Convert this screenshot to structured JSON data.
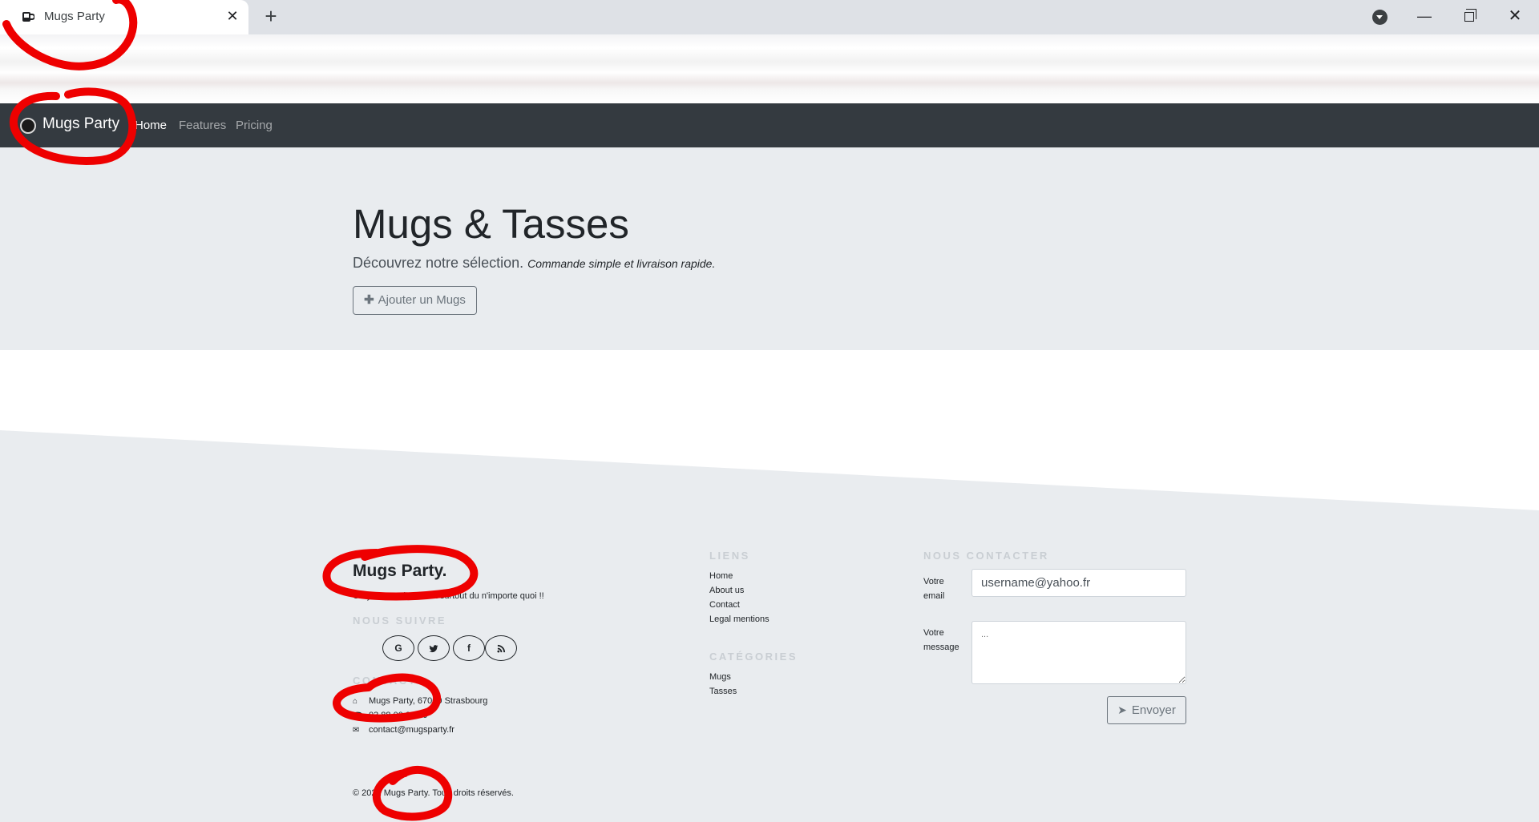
{
  "browser": {
    "tab_title": "Mugs Party",
    "tab_close": "✕",
    "new_tab": "+",
    "window_minimize": "—",
    "window_close": "✕"
  },
  "navbar": {
    "brand": "Mugs Party",
    "links": [
      "Home",
      "Features",
      "Pricing"
    ],
    "active": "Home"
  },
  "hero": {
    "title": "Mugs & Tasses",
    "lead": "Découvrez notre sélection.",
    "lead_emphasis": "Commande simple et livraison rapide.",
    "add_button": "Ajouter un Mugs"
  },
  "footer": {
    "brand": "Mugs Party.",
    "tagline": "On y trouve de tout et surtout du n'importe quoi !!",
    "follow_heading": "NOUS SUIVRE",
    "social": [
      "G",
      "t",
      "f",
      "rss"
    ],
    "contact_heading": "CONTACT",
    "address": "Mugs Party, 67000 Strasbourg",
    "phone": "03 88 00 00 00",
    "email": "contact@mugsparty.fr",
    "links_heading": "LIENS",
    "links": [
      "Home",
      "About us",
      "Contact",
      "Legal mentions"
    ],
    "categories_heading": "CATÉGORIES",
    "categories": [
      "Mugs",
      "Tasses"
    ],
    "contact_form_heading": "NOUS CONTACTER",
    "email_label": "Votre email",
    "email_value": "username@yahoo.fr",
    "message_label": "Votre message",
    "message_placeholder": "...",
    "send_button": "Envoyer",
    "copyright": "© 2021 Mugs Party. Tous droits réservés."
  },
  "colors": {
    "navbar_bg": "#343a40",
    "hero_bg": "#e9ecef",
    "annotation_red": "#ee0000"
  }
}
